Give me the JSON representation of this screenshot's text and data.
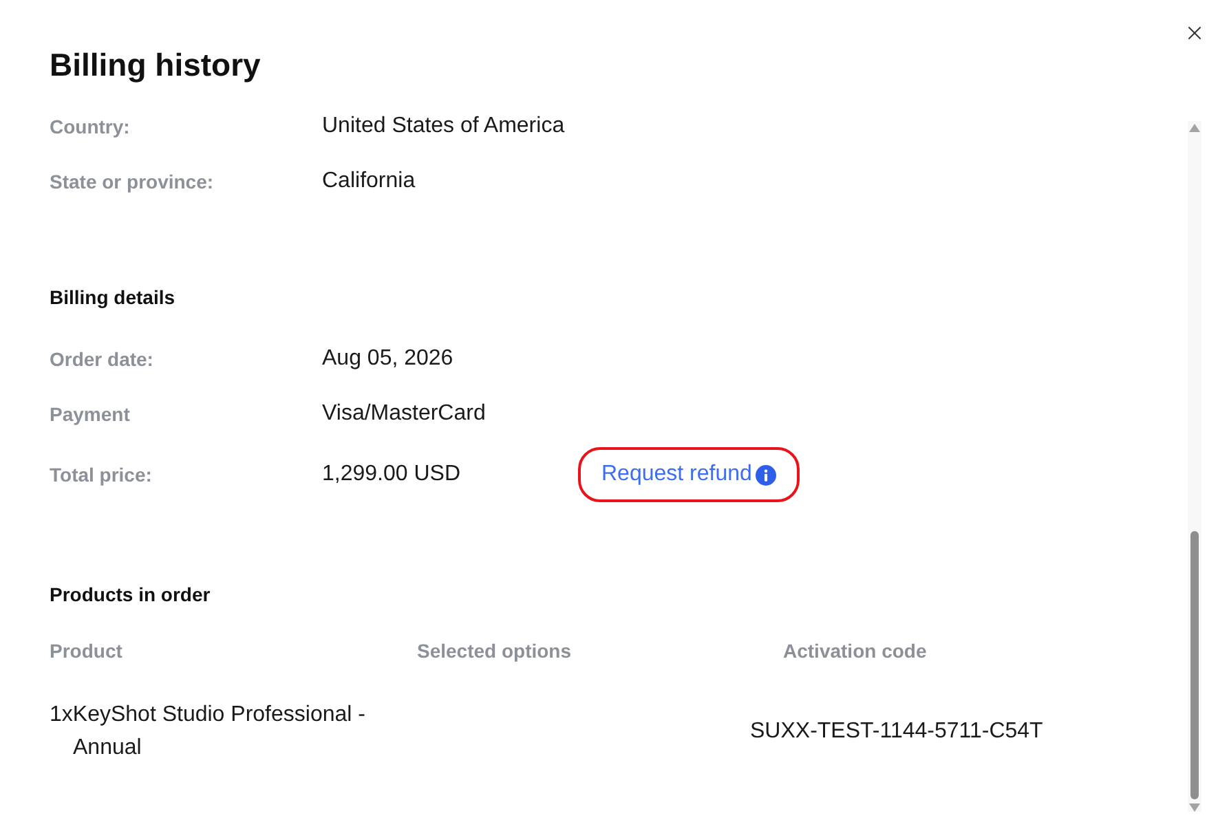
{
  "dialog": {
    "title": "Billing history"
  },
  "address": [
    {
      "label": "Country:",
      "value": "United States of America"
    },
    {
      "label": "State or province:",
      "value": "California"
    }
  ],
  "billing_details": {
    "heading": "Billing details",
    "rows": [
      {
        "label": "Order date:",
        "value": "Aug 05, 2026"
      },
      {
        "label": "Payment",
        "value": "Visa/MasterCard"
      },
      {
        "label": "Total price:",
        "value": "1,299.00 USD",
        "action": "Request refund"
      }
    ]
  },
  "products": {
    "heading": "Products in order",
    "columns": [
      "Product",
      "Selected options",
      "Activation code"
    ],
    "rows": [
      {
        "product": "1xKeyShot Studio Professional - Annual",
        "activation_code": "SUXX-TEST-1144-5711-C54T"
      }
    ]
  }
}
